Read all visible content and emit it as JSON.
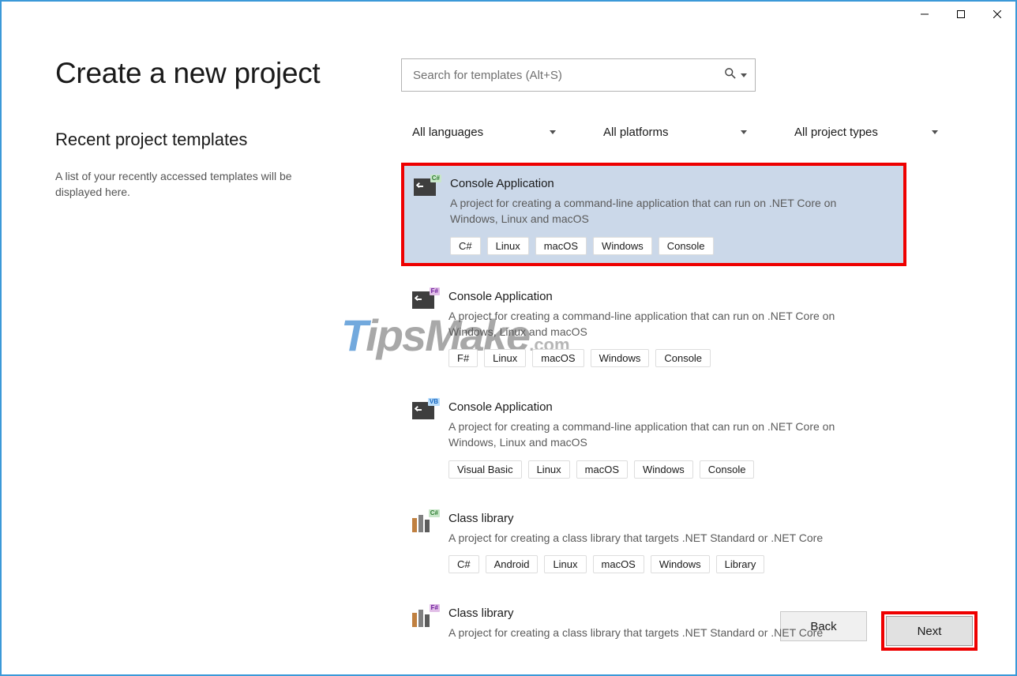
{
  "page": {
    "title": "Create a new project"
  },
  "recent": {
    "heading": "Recent project templates",
    "empty_text": "A list of your recently accessed templates will be displayed here."
  },
  "search": {
    "placeholder": "Search for templates (Alt+S)"
  },
  "filters": {
    "language": "All languages",
    "platform": "All platforms",
    "project_type": "All project types"
  },
  "templates": [
    {
      "icon_badge": "C#",
      "badge_class": "badge-cs",
      "icon_type": "console",
      "title": "Console Application",
      "description": "A project for creating a command-line application that can run on .NET Core on Windows, Linux and macOS",
      "tags": [
        "C#",
        "Linux",
        "macOS",
        "Windows",
        "Console"
      ],
      "selected": true
    },
    {
      "icon_badge": "F#",
      "badge_class": "badge-fs",
      "icon_type": "console",
      "title": "Console Application",
      "description": "A project for creating a command-line application that can run on .NET Core on Windows, Linux and macOS",
      "tags": [
        "F#",
        "Linux",
        "macOS",
        "Windows",
        "Console"
      ],
      "selected": false
    },
    {
      "icon_badge": "VB",
      "badge_class": "badge-vb",
      "icon_type": "console",
      "title": "Console Application",
      "description": "A project for creating a command-line application that can run on .NET Core on Windows, Linux and macOS",
      "tags": [
        "Visual Basic",
        "Linux",
        "macOS",
        "Windows",
        "Console"
      ],
      "selected": false
    },
    {
      "icon_badge": "C#",
      "badge_class": "badge-cs",
      "icon_type": "library",
      "title": "Class library",
      "description": "A project for creating a class library that targets .NET Standard or .NET Core",
      "tags": [
        "C#",
        "Android",
        "Linux",
        "macOS",
        "Windows",
        "Library"
      ],
      "selected": false
    },
    {
      "icon_badge": "F#",
      "badge_class": "badge-fs",
      "icon_type": "library",
      "title": "Class library",
      "description": "A project for creating a class library that targets .NET Standard or .NET Core",
      "tags": [],
      "selected": false
    }
  ],
  "buttons": {
    "back": "Back",
    "next": "Next"
  },
  "watermark": {
    "t": "T",
    "rest": "ipsMake",
    "dot": ".com"
  }
}
